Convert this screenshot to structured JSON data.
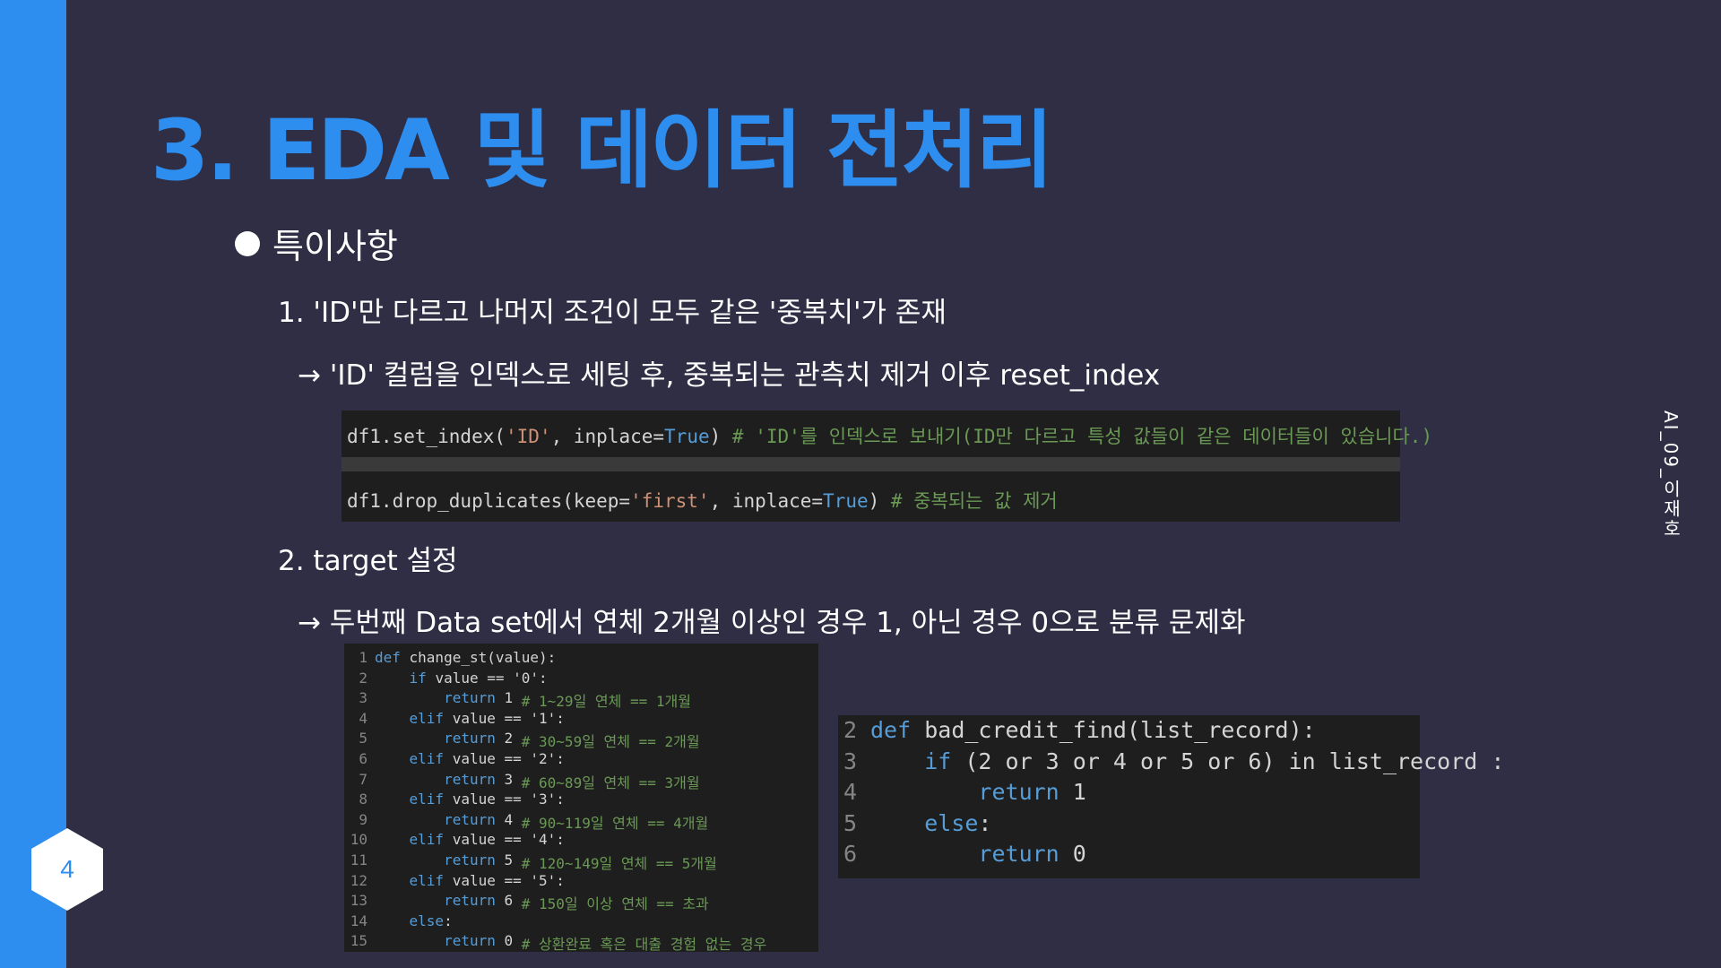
{
  "slide": {
    "title": "3. EDA 및 데이터 전처리",
    "page_number": "4",
    "side_label": "AI_09_이재호",
    "bullet_heading": "특이사항",
    "item1": "1. 'ID'만 다르고 나머지 조건이 모두 같은 '중복치'가 존재",
    "item1_sub": "→ 'ID' 컬럼을 인덱스로 세팅 후, 중복되는 관측치 제거 이후 reset_index",
    "item2": "2. target 설정",
    "item2_sub": "→ 두번째 Data set에서 연체 2개월 이상인 경우 1, 아닌 경우 0으로 분류 문제화"
  },
  "code_a": {
    "line1": {
      "a": "df1.set_index(",
      "b": "'ID'",
      "c": ", inplace=",
      "d": "True",
      "e": ") ",
      "f": "# 'ID'를 인덱스로 보내기(ID만 다르고 특성 값들이 같은 데이터들이 있습니다.)"
    },
    "line2": {
      "a": "df1.drop_duplicates(keep=",
      "b": "'first'",
      "c": ", inplace=",
      "d": "True",
      "e": ") ",
      "f": "# 중복되는 값 제거"
    }
  },
  "code_b": {
    "lines": [
      {
        "n": "1",
        "kw": "def ",
        "t": "change_st(value):",
        "cm": ""
      },
      {
        "n": "2",
        "kw": "    if ",
        "t": "value == '0':",
        "cm": ""
      },
      {
        "n": "3",
        "kw": "        return ",
        "t": "1 ",
        "cm": "# 1~29일 연체 == 1개월"
      },
      {
        "n": "4",
        "kw": "    elif ",
        "t": "value == '1':",
        "cm": ""
      },
      {
        "n": "5",
        "kw": "        return ",
        "t": "2 ",
        "cm": "# 30~59일 연체 == 2개월"
      },
      {
        "n": "6",
        "kw": "    elif ",
        "t": "value == '2':",
        "cm": ""
      },
      {
        "n": "7",
        "kw": "        return ",
        "t": "3 ",
        "cm": "# 60~89일 연체 == 3개월"
      },
      {
        "n": "8",
        "kw": "    elif ",
        "t": "value == '3':",
        "cm": ""
      },
      {
        "n": "9",
        "kw": "        return ",
        "t": "4 ",
        "cm": "# 90~119일 연체 == 4개월"
      },
      {
        "n": "10",
        "kw": "    elif ",
        "t": "value == '4':",
        "cm": ""
      },
      {
        "n": "11",
        "kw": "        return ",
        "t": "5 ",
        "cm": "# 120~149일 연체 == 5개월"
      },
      {
        "n": "12",
        "kw": "    elif ",
        "t": "value == '5':",
        "cm": ""
      },
      {
        "n": "13",
        "kw": "        return ",
        "t": "6 ",
        "cm": "# 150일 이상 연체 == 초과"
      },
      {
        "n": "14",
        "kw": "    else",
        "t": ":",
        "cm": ""
      },
      {
        "n": "15",
        "kw": "        return ",
        "t": "0 ",
        "cm": "# 상환완료 혹은 대출 경험 없는 경우"
      }
    ]
  },
  "code_c": {
    "lines": [
      {
        "n": "2",
        "kw": "def ",
        "t": "bad_credit_find(list_record):"
      },
      {
        "n": "3",
        "kw": "    if ",
        "t": "(2 or 3 or 4 or 5 or 6) in list_record :"
      },
      {
        "n": "4",
        "kw": "        return ",
        "t": "1"
      },
      {
        "n": "5",
        "kw": "    else",
        "t": ":"
      },
      {
        "n": "6",
        "kw": "        return ",
        "t": "0"
      }
    ]
  },
  "colors": {
    "accent": "#2e8ef0",
    "background": "#2f2e44",
    "code_bg": "#1e1e1e"
  }
}
